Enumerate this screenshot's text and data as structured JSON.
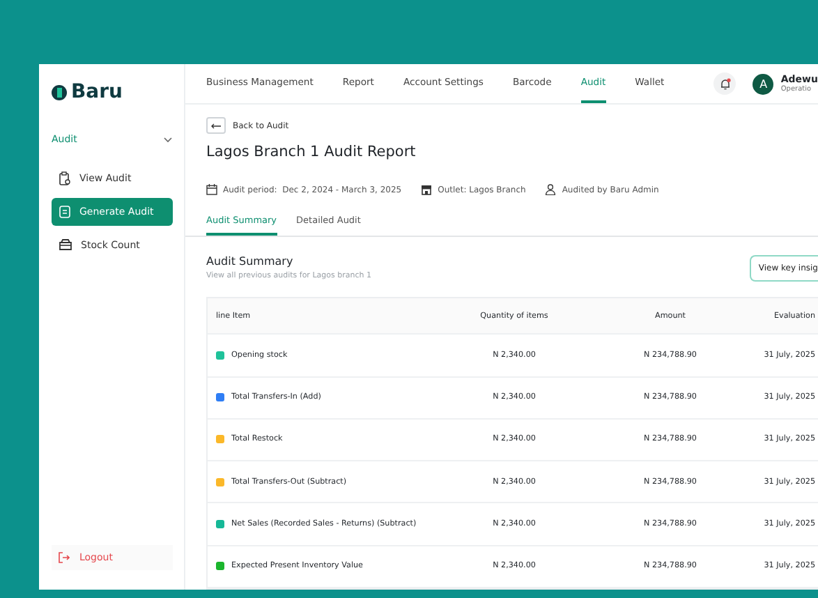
{
  "logo": {
    "name": "Baru"
  },
  "sidebar": {
    "section": {
      "label": "Audit",
      "expanded": true
    },
    "items": [
      {
        "label": "View Audit",
        "selected": false
      },
      {
        "label": "Generate Audit",
        "selected": true
      },
      {
        "label": "Stock Count",
        "selected": false
      }
    ],
    "logout": "Logout"
  },
  "nav": {
    "tabs": [
      {
        "label": "Business Management",
        "selected": false
      },
      {
        "label": "Report",
        "selected": false
      },
      {
        "label": "Account Settings",
        "selected": false
      },
      {
        "label": "Barcode",
        "selected": false
      },
      {
        "label": "Audit",
        "selected": true
      },
      {
        "label": "Wallet",
        "selected": false
      }
    ],
    "notification_unread": true,
    "user": {
      "initial": "A",
      "name": "Adewu",
      "role": "Operatio"
    }
  },
  "back_link": "Back to Audit",
  "title": "Lagos Branch 1 Audit Report",
  "meta": [
    {
      "kind": "calendar",
      "label": "Audit period:",
      "value": "Dec 2, 2024 - March 3, 2025"
    },
    {
      "kind": "store",
      "label": "Outlet: Lagos Branch"
    },
    {
      "kind": "person",
      "label": "Audited by Baru Admin"
    }
  ],
  "tabs": [
    {
      "label": "Audit Summary",
      "selected": true
    },
    {
      "label": "Detailed Audit",
      "selected": false
    }
  ],
  "summary": {
    "title": "Audit Summary",
    "subtitle": "View all previous audits for Lagos branch 1",
    "button": "View key insig"
  },
  "table": {
    "columns": [
      "line Item",
      "Quantity of items",
      "Amount",
      "Evaluation"
    ],
    "rows": [
      {
        "item": "Opening stock",
        "color": "#1fc29a",
        "quantity": "N 2,340.00",
        "amount": "N 234,788.90",
        "evaluation": "31 July, 2025"
      },
      {
        "item": "Total Transfers-In (Add)",
        "color": "#2f7ef5",
        "quantity": "N 2,340.00",
        "amount": "N 234,788.90",
        "evaluation": "31 July, 2025"
      },
      {
        "item": "Total Restock",
        "color": "#fbb829",
        "quantity": "N 2,340.00",
        "amount": "N 234,788.90",
        "evaluation": "31 July, 2025"
      },
      {
        "item": "Total Transfers-Out (Subtract)",
        "color": "#fbb829",
        "quantity": "N 2,340.00",
        "amount": "N 234,788.90",
        "evaluation": "31 July, 2025"
      },
      {
        "item": "Net Sales (Recorded Sales - Returns) (Subtract)",
        "color": "#16b897",
        "quantity": "N 2,340.00",
        "amount": "N 234,788.90",
        "evaluation": "31 July, 2025"
      },
      {
        "item": "Expected Present Inventory Value",
        "color": "#1bb52d",
        "quantity": "N 2,340.00",
        "amount": "N 234,788.90",
        "evaluation": "31 July, 2025"
      }
    ]
  }
}
